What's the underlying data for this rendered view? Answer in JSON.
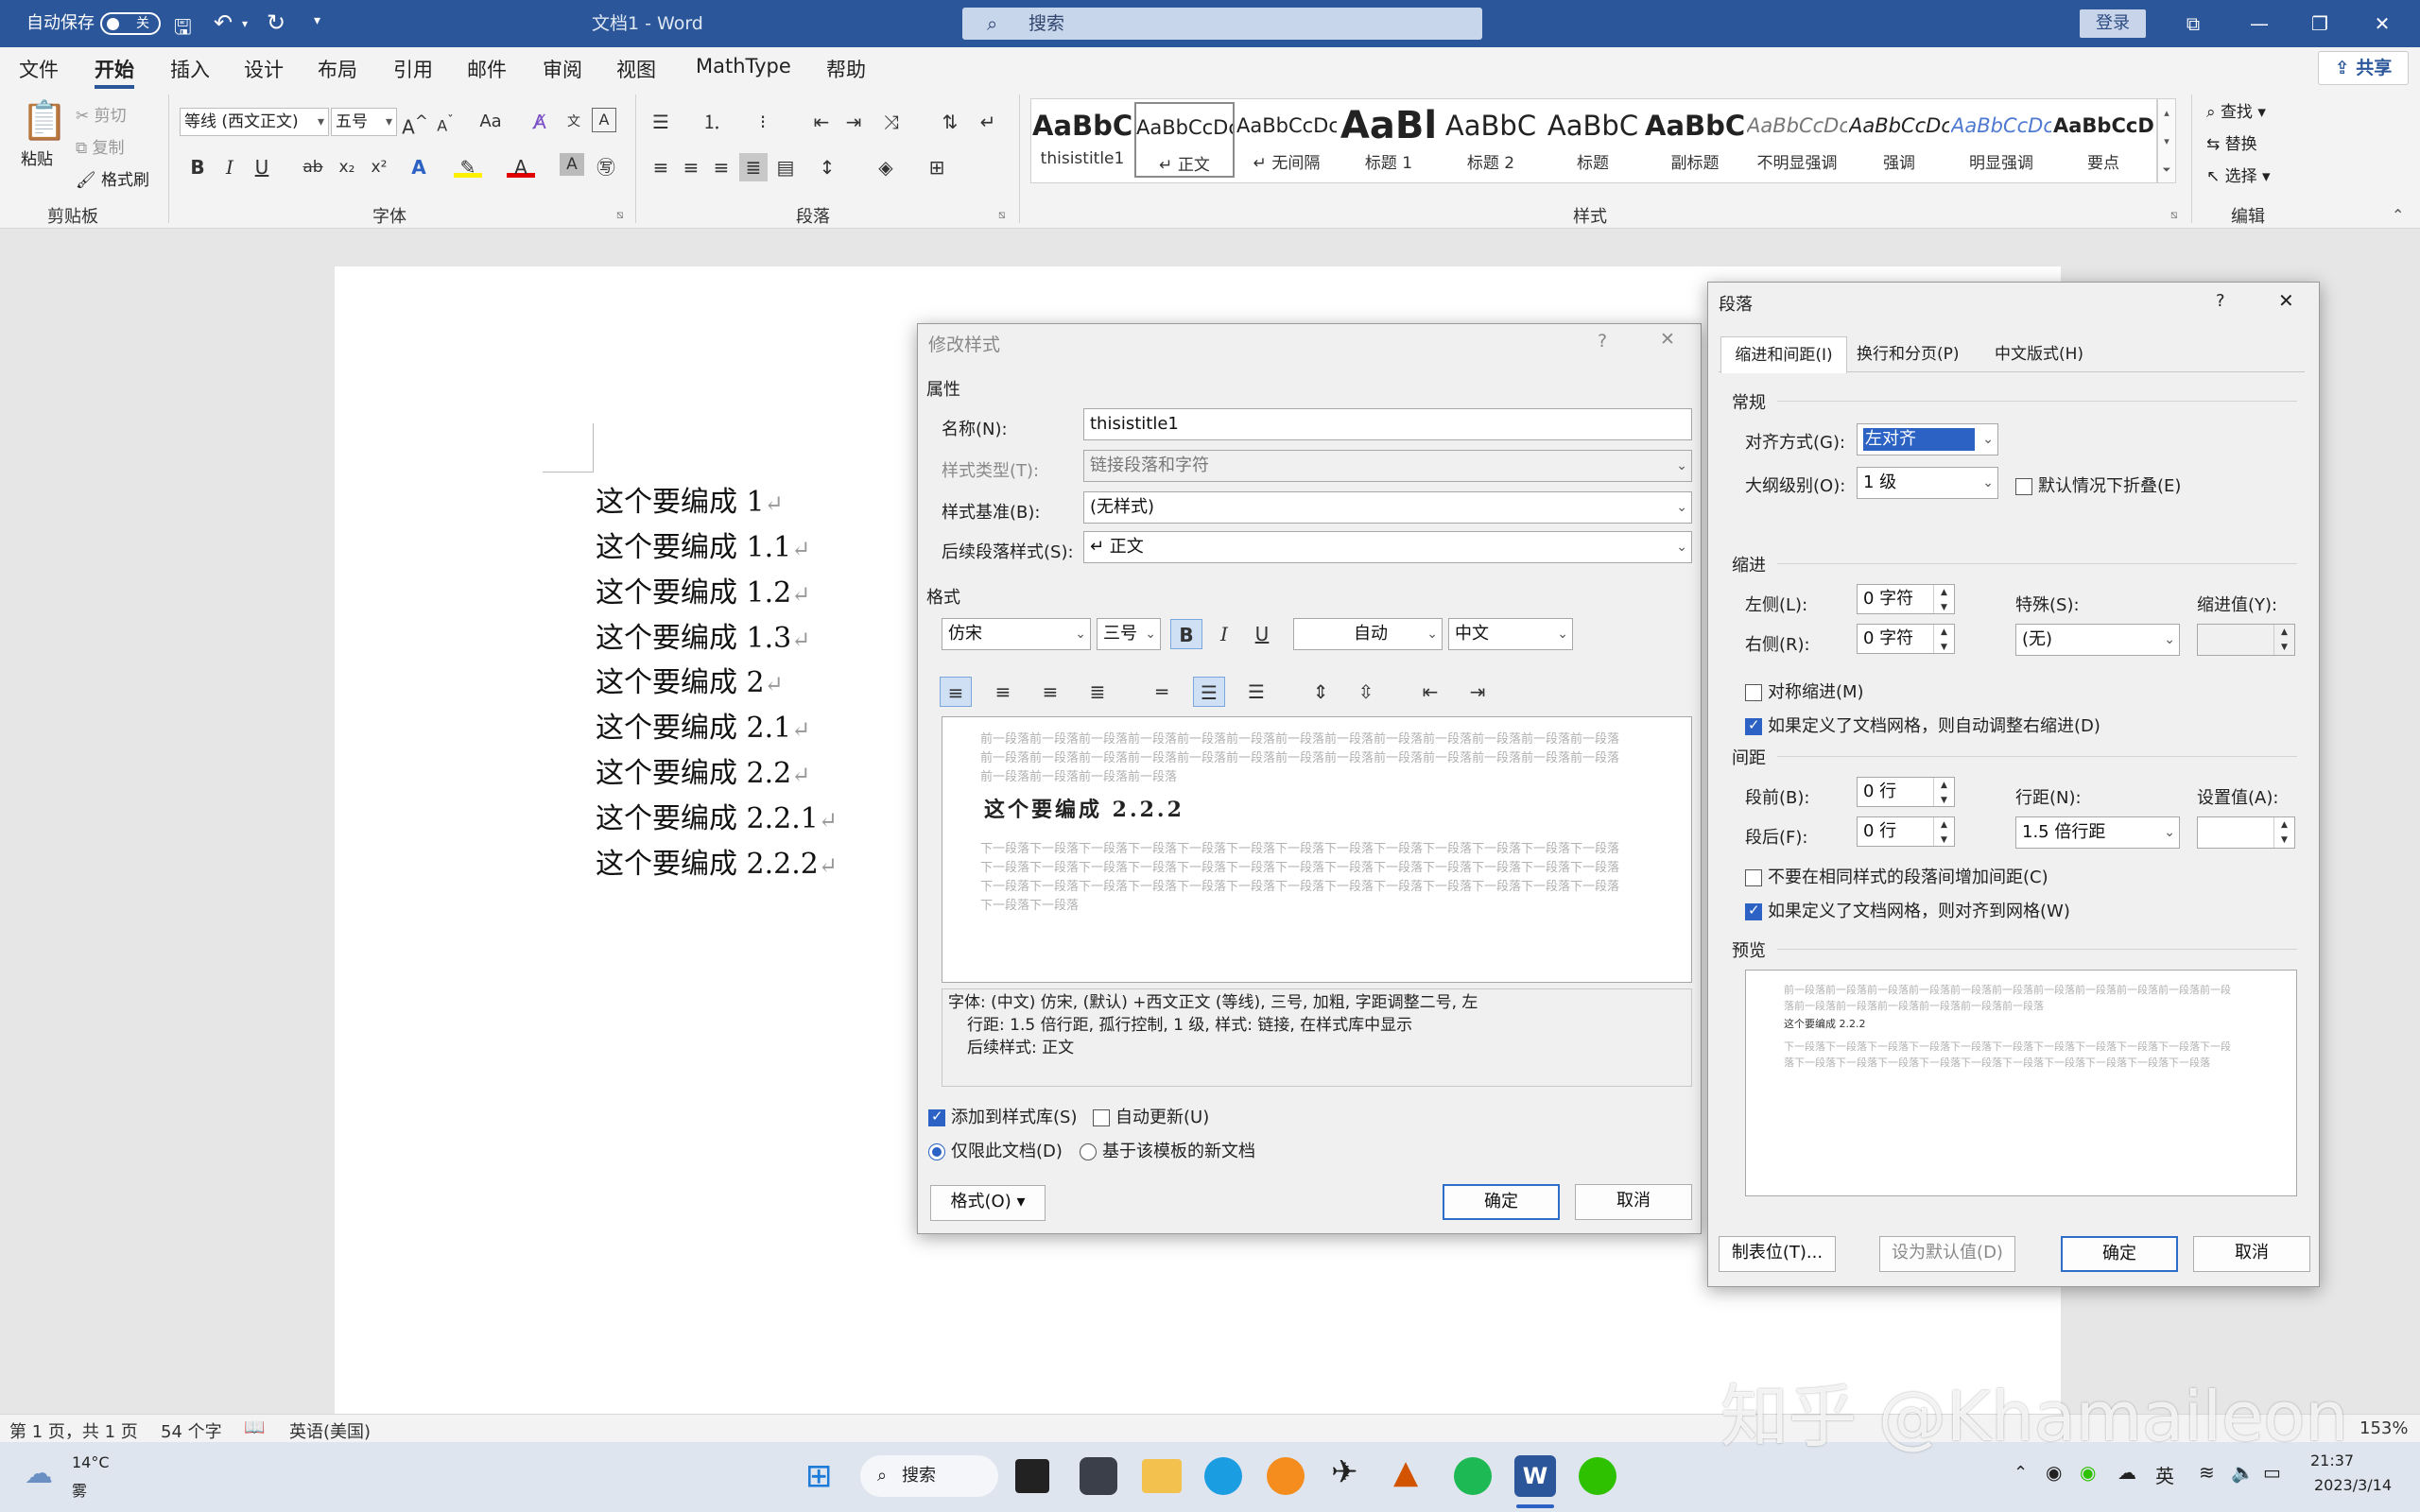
{
  "titlebar": {
    "autosave_label": "自动保存",
    "autosave_state": "关",
    "doc_title": "文档1 - Word",
    "search_placeholder": "搜索",
    "login_label": "登录"
  },
  "menu": {
    "tabs": [
      "文件",
      "开始",
      "插入",
      "设计",
      "布局",
      "引用",
      "邮件",
      "审阅",
      "视图",
      "MathType",
      "帮助"
    ],
    "share_label": "共享"
  },
  "ribbon": {
    "clipboard": {
      "paste": "粘贴",
      "cut": "剪切",
      "copy": "复制",
      "format_painter": "格式刷",
      "group": "剪贴板"
    },
    "font": {
      "font_name": "等线 (西文正文)",
      "font_size": "五号",
      "change_case": "Aa",
      "group": "字体"
    },
    "paragraph": {
      "group": "段落"
    },
    "styles": {
      "group": "样式",
      "items": [
        {
          "preview": "AaBbC",
          "name": "thisistitle1"
        },
        {
          "preview": "AaBbCcDc",
          "name": "↵ 正文"
        },
        {
          "preview": "AaBbCcDc",
          "name": "↵ 无间隔"
        },
        {
          "preview": "AaBl",
          "name": "标题 1"
        },
        {
          "preview": "AaBbC",
          "name": "标题 2"
        },
        {
          "preview": "AaBbC",
          "name": "标题"
        },
        {
          "preview": "AaBbC",
          "name": "副标题"
        },
        {
          "preview": "AaBbCcDc",
          "name": "不明显强调"
        },
        {
          "preview": "AaBbCcDc",
          "name": "强调"
        },
        {
          "preview": "AaBbCcDc",
          "name": "明显强调"
        },
        {
          "preview": "AaBbCcD",
          "name": "要点"
        }
      ]
    },
    "editing": {
      "find": "查找",
      "replace": "替换",
      "select": "选择",
      "group": "编辑"
    }
  },
  "document": {
    "lines": [
      "这个要编成 1",
      "这个要编成 1.1",
      "这个要编成 1.2",
      "这个要编成 1.3",
      "这个要编成 2",
      "这个要编成 2.1",
      "这个要编成 2.2",
      "这个要编成 2.2.1",
      "这个要编成 2.2.2"
    ],
    "para_mark": "↵"
  },
  "modify_style": {
    "title": "修改样式",
    "help": "?",
    "close": "✕",
    "properties_header": "属性",
    "name_label": "名称(N):",
    "name_value": "thisistitle1",
    "type_label": "样式类型(T):",
    "type_value": "链接段落和字符",
    "based_label": "样式基准(B):",
    "based_value": "(无样式)",
    "next_label": "后续段落样式(S):",
    "next_value": "↵ 正文",
    "format_header": "格式",
    "font_value": "仿宋",
    "size_value": "三号",
    "bold": "B",
    "italic": "I",
    "underline": "U",
    "color_value": "自动",
    "lang_value": "中文",
    "preview_before": "前一段落前一段落前一段落前一段落前一段落前一段落前一段落前一段落前一段落前一段落前一段落前一段落前一段落前一段落前一段落前一段落前一段落前一段落前一段落前一段落前一段落前一段落前一段落前一段落前一段落前一段落前一段落前一段落前一段落前一段落",
    "preview_sample": "这个要编成 2.2.2",
    "preview_after": "下一段落下一段落下一段落下一段落下一段落下一段落下一段落下一段落下一段落下一段落下一段落下一段落下一段落下一段落下一段落下一段落下一段落下一段落下一段落下一段落下一段落下一段落下一段落下一段落下一段落下一段落下一段落下一段落下一段落下一段落下一段落下一段落下一段落下一段落下一段落下一段落下一段落下一段落下一段落下一段落下一段落",
    "description_lines": [
      "字体: (中文) 仿宋, (默认) +西文正文 (等线), 三号, 加粗, 字距调整二号, 左",
      "行距: 1.5 倍行距, 孤行控制, 1 级, 样式: 链接, 在样式库中显示",
      "后续样式: 正文"
    ],
    "add_to_gallery": "添加到样式库(S)",
    "auto_update": "自动更新(U)",
    "this_doc_only": "仅限此文档(D)",
    "new_docs_template": "基于该模板的新文档",
    "format_button": "格式(O)",
    "ok": "确定",
    "cancel": "取消"
  },
  "paragraph_dialog": {
    "title": "段落",
    "help": "?",
    "close": "✕",
    "tabs": [
      "缩进和间距(I)",
      "换行和分页(P)",
      "中文版式(H)"
    ],
    "general_header": "常规",
    "align_label": "对齐方式(G):",
    "align_value": "左对齐",
    "outline_label": "大纲级别(O):",
    "outline_value": "1 级",
    "collapse_label": "默认情况下折叠(E)",
    "indent_header": "缩进",
    "left_label": "左侧(L):",
    "left_value": "0 字符",
    "right_label": "右侧(R):",
    "right_value": "0 字符",
    "special_label": "特殊(S):",
    "special_value": "(无)",
    "indent_by_label": "缩进值(Y):",
    "mirror_label": "对称缩进(M)",
    "auto_adjust_label": "如果定义了文档网格，则自动调整右缩进(D)",
    "spacing_header": "间距",
    "before_label": "段前(B):",
    "before_value": "0 行",
    "after_label": "段后(F):",
    "after_value": "0 行",
    "line_spacing_label": "行距(N):",
    "line_spacing_value": "1.5 倍行距",
    "at_label": "设置值(A):",
    "no_space_label": "不要在相同样式的段落间增加间距(C)",
    "snap_grid_label": "如果定义了文档网格，则对齐到网格(W)",
    "preview_header": "预览",
    "preview_before": "前一段落前一段落前一段落前一段落前一段落前一段落前一段落前一段落前一段落前一段落前一段落前一段落前一段落前一段落前一段落前一段落前一段落",
    "preview_sample": "这个要编成 2.2.2",
    "preview_after": "下一段落下一段落下一段落下一段落下一段落下一段落下一段落下一段落下一段落下一段落下一段落下一段落下一段落下一段落下一段落下一段落下一段落下一段落下一段落下一段落下一段落",
    "tabs_button": "制表位(T)...",
    "default_button": "设为默认值(D)",
    "ok": "确定",
    "cancel": "取消"
  },
  "statusbar": {
    "page": "第 1 页，共 1 页",
    "words": "54 个字",
    "language": "英语(美国)",
    "zoom": "153%"
  },
  "taskbar": {
    "weather_temp": "14°C",
    "weather_desc": "雾",
    "search_label": "搜索",
    "ime": "英",
    "time": "21:37",
    "date": "2023/3/14"
  },
  "watermark": "知乎 @Khamaileon",
  "colors": {
    "word_blue": "#2b579a",
    "accent": "#2b62c4"
  }
}
